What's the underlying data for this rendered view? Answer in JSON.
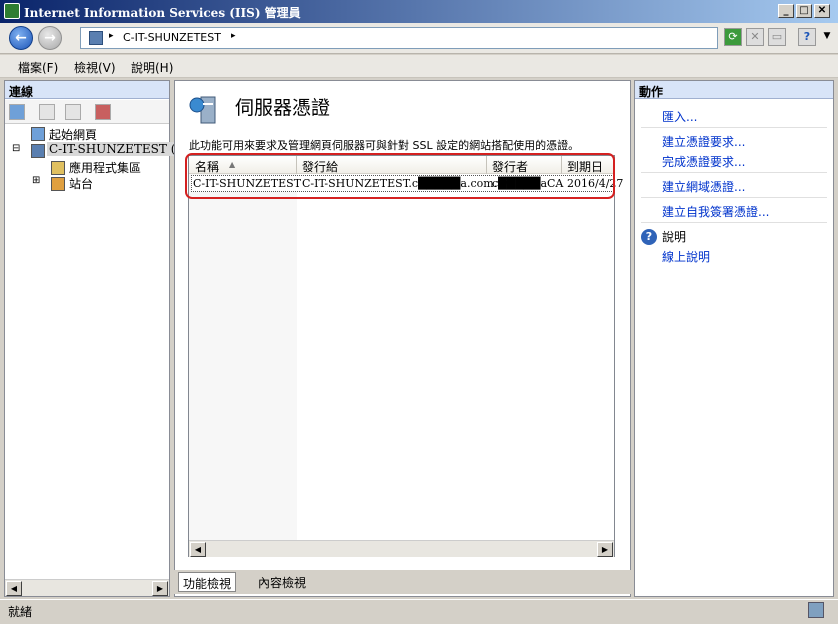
{
  "window": {
    "title": "Internet Information Services (IIS) 管理員"
  },
  "address": {
    "breadcrumb": "C-IT-SHUNZETEST",
    "separator": "▸"
  },
  "menu": [
    {
      "label": "檔案(F)"
    },
    {
      "label": "檢視(V)"
    },
    {
      "label": "說明(H)"
    }
  ],
  "connections": {
    "title": "連線",
    "tree": [
      {
        "label": "起始網頁",
        "icon": "start-page-icon"
      },
      {
        "label": "C-IT-SHUNZETEST (CH",
        "icon": "server-icon",
        "selected": true
      },
      {
        "label": "應用程式集區",
        "icon": "app-pool-icon"
      },
      {
        "label": "站台",
        "icon": "sites-icon"
      }
    ]
  },
  "feature": {
    "title": "伺服器憑證",
    "description": "此功能可用來要求及管理網頁伺服器可與針對 SSL 設定的網站搭配使用的憑證。",
    "columns": [
      "名稱",
      "發行給",
      "發行者",
      "到期日"
    ],
    "rows": [
      [
        "C-IT-SHUNZETEST",
        "C-IT-SHUNZETEST.c█████a.com.tw",
        "c█████aCA",
        "2016/4/27"
      ]
    ]
  },
  "view_tabs": {
    "feature": "功能檢視",
    "content": "內容檢視"
  },
  "actions": {
    "title": "動作",
    "items": [
      "匯入...",
      "建立憑證要求...",
      "完成憑證要求...",
      "建立網域憑證...",
      "建立自我簽署憑證..."
    ],
    "help": "說明",
    "online_help": "線上說明"
  },
  "status": {
    "text": "就緒"
  },
  "colors": {
    "link": "#0033cc",
    "highlight": "#d42020",
    "title_bar": "#0a246a"
  }
}
